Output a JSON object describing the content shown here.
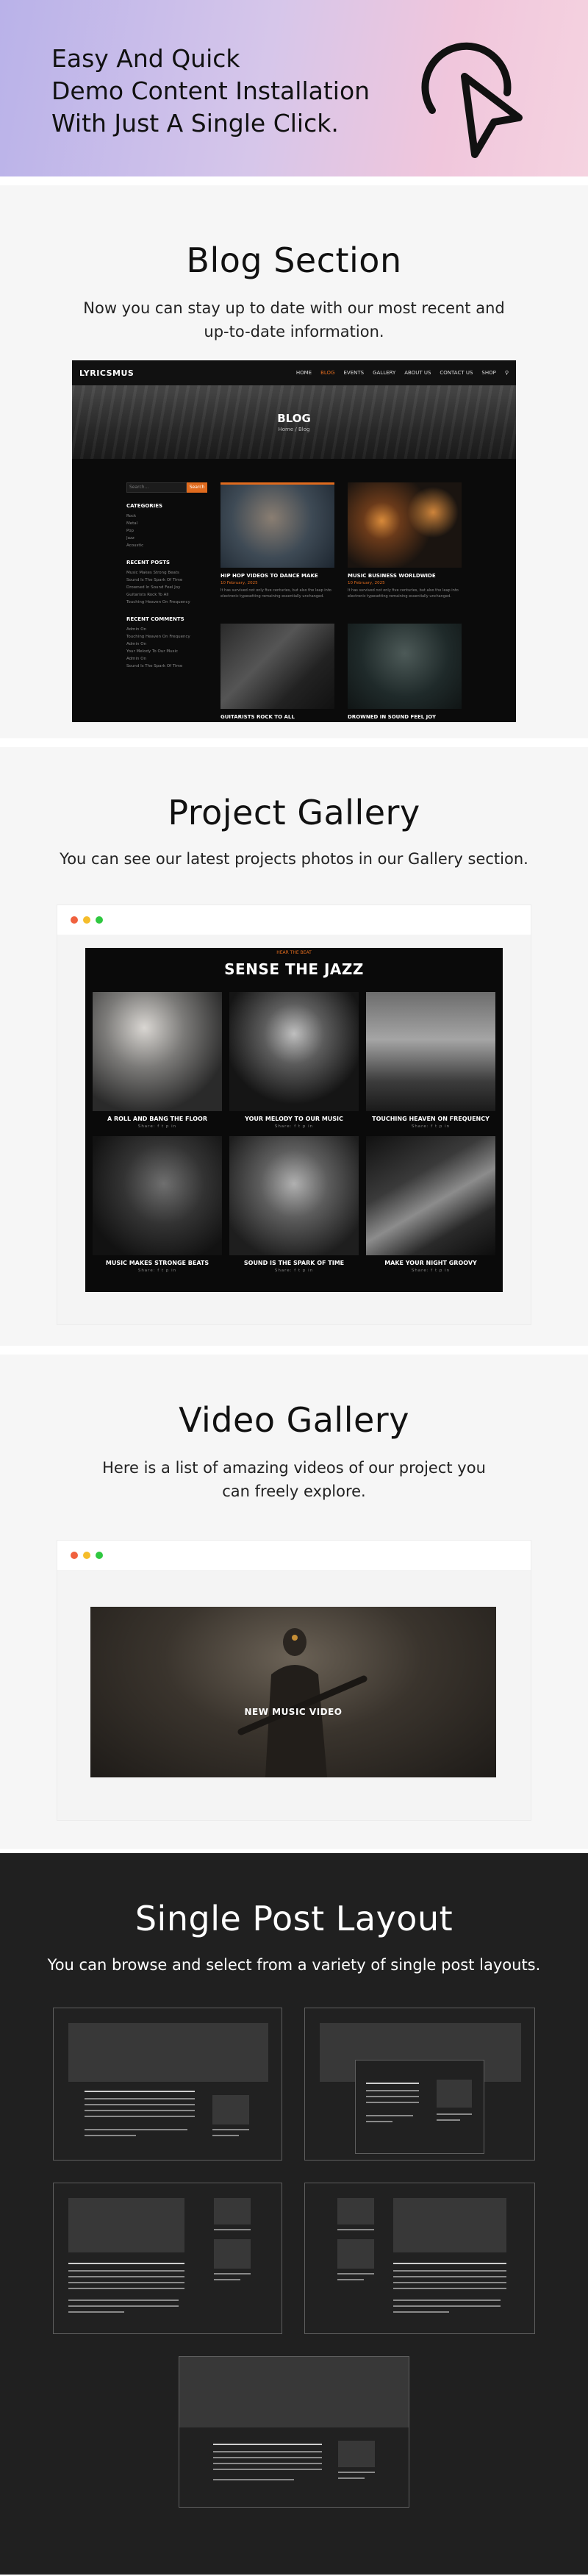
{
  "hero": {
    "lines": [
      "Easy And Quick",
      "Demo Content Installation",
      "With Just A Single Click."
    ],
    "icon": "cursor-click-icon"
  },
  "blog_section": {
    "title": "Blog Section",
    "subtitle": "Now you can stay up to date with our most recent and up-to-date information.",
    "site": {
      "logo": "LYRICSMUS",
      "menu": [
        "HOME",
        "BLOG",
        "EVENTS",
        "GALLERY",
        "ABOUT US",
        "CONTACT US",
        "SHOP"
      ],
      "active_menu": "BLOG",
      "banner_title": "BLOG",
      "breadcrumb": "Home / Blog",
      "search_placeholder": "Search...",
      "search_button": "Search",
      "categories_title": "CATEGORIES",
      "categories": [
        "Rock",
        "Metal",
        "Pop",
        "Jazz",
        "Acoustic"
      ],
      "recent_posts_title": "RECENT POSTS",
      "recent_posts": [
        "Music Makes Strong Beats",
        "Sound Is The Spark Of Time",
        "Drowned In Sound Feel Joy",
        "Guitarists Rock To All",
        "Touching Heaven On Frequency"
      ],
      "recent_comments_title": "RECENT COMMENTS",
      "recent_comments": [
        "Admin On",
        "Touching Heaven On Frequency",
        "Admin On",
        "Your Melody To Our Music",
        "Admin On",
        "Sound Is The Spark Of Time"
      ],
      "posts": [
        {
          "title": "HIP HOP VIDEOS TO DANCE MAKE",
          "date": "10 February, 2025",
          "excerpt": "It has survived not only five centuries, but also the leap into electronic typesetting remaining essentially unchanged."
        },
        {
          "title": "MUSIC BUSINESS WORLDWIDE",
          "date": "10 February, 2025",
          "excerpt": "It has survived not only five centuries, but also the leap into electronic typesetting remaining essentially unchanged."
        },
        {
          "title": "GUITARISTS ROCK TO ALL",
          "date": "",
          "excerpt": ""
        },
        {
          "title": "DROWNED IN SOUND FEEL JOY",
          "date": "",
          "excerpt": ""
        }
      ]
    }
  },
  "project_gallery": {
    "title": "Project Gallery",
    "subtitle": "You can see our latest projects photos in our Gallery section.",
    "kicker": "HEAR THE BEAT",
    "heading": "SENSE THE JAZZ",
    "items": [
      {
        "caption": "A ROLL AND BANG THE FLOOR",
        "meta": "Share: f t p in"
      },
      {
        "caption": "YOUR MELODY TO OUR MUSIC",
        "meta": "Share: f t p in"
      },
      {
        "caption": "TOUCHING HEAVEN ON FREQUENCY",
        "meta": "Share: f t p in"
      },
      {
        "caption": "MUSIC MAKES STRONGE BEATS",
        "meta": "Share: f t p in"
      },
      {
        "caption": "SOUND IS THE SPARK OF TIME",
        "meta": "Share: f t p in"
      },
      {
        "caption": "MAKE YOUR NIGHT GROOVY",
        "meta": "Share: f t p in"
      }
    ]
  },
  "video_gallery": {
    "title": "Video Gallery",
    "subtitle": "Here is a list of amazing videos of our project you can freely explore.",
    "video_label": "NEW MUSIC VIDEO"
  },
  "single_post": {
    "title": "Single Post Layout",
    "subtitle": "You can browse and select from a variety of single post layouts."
  }
}
